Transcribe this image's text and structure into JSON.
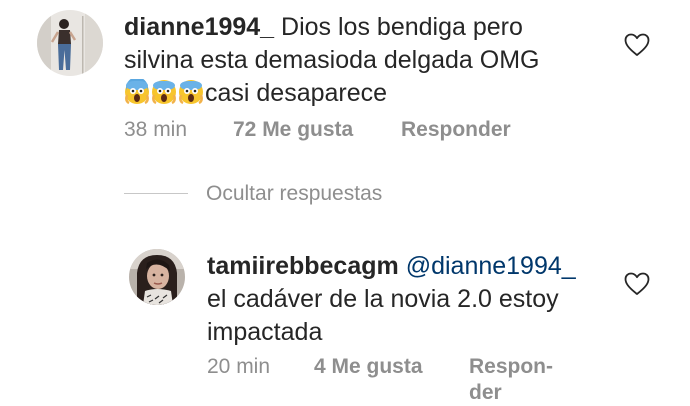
{
  "comment": {
    "username": "dianne1994_",
    "text_line1": "Dios los bendiga pero",
    "text_line2": "silvina esta demasioda delgada OMG",
    "text_line3": "casi desaparece",
    "emojis": [
      "face-screaming-in-fear-icon",
      "face-screaming-in-fear-icon",
      "face-screaming-in-fear-icon"
    ],
    "time": "38 min",
    "likes": "72 Me gusta",
    "reply_label": "Responder"
  },
  "hide_replies_label": "Ocultar respuestas",
  "reply": {
    "username": "tamiirebbecagm",
    "mention": "@dianne1994_",
    "text_line1": "el cadáver de la novia 2.0 estoy",
    "text_line2": "impactada",
    "time": "20 min",
    "likes": "4 Me gusta",
    "reply_label_line1": "Respon-",
    "reply_label_line2": "der"
  },
  "colors": {
    "text": "#262626",
    "meta": "#8e8e8e",
    "mention": "#00376b",
    "divider": "#c7c7c7"
  }
}
